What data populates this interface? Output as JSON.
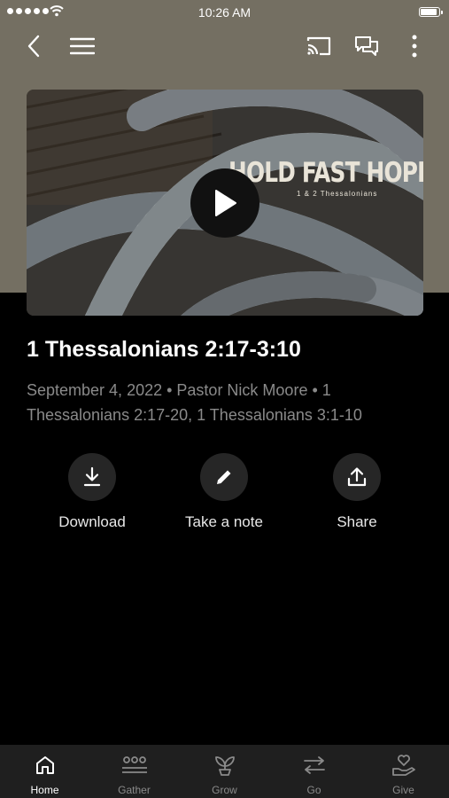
{
  "status_bar": {
    "time": "10:26 AM"
  },
  "header": {
    "back_icon": "chevron-left-icon",
    "menu_icon": "hamburger-menu-icon",
    "cast_icon": "cast-icon",
    "chat_icon": "chat-icon",
    "more_icon": "more-vertical-icon"
  },
  "video": {
    "thumbnail_title": "HOLD FAST HOPE",
    "thumbnail_subtitle": "1 & 2 Thessalonians",
    "play_icon": "play-icon"
  },
  "sermon": {
    "title": "1 Thessalonians 2:17-3:10",
    "meta": "September 4, 2022 • Pastor Nick Moore • 1 Thessalonians 2:17-20, 1 Thessalonians 3:1-10"
  },
  "actions": [
    {
      "label": "Download",
      "icon": "download-icon"
    },
    {
      "label": "Take a note",
      "icon": "pencil-icon"
    },
    {
      "label": "Share",
      "icon": "share-icon"
    }
  ],
  "tabs": [
    {
      "label": "Home",
      "icon": "home-icon",
      "active": true
    },
    {
      "label": "Gather",
      "icon": "group-icon",
      "active": false
    },
    {
      "label": "Grow",
      "icon": "plant-icon",
      "active": false
    },
    {
      "label": "Go",
      "icon": "arrows-icon",
      "active": false
    },
    {
      "label": "Give",
      "icon": "heart-hand-icon",
      "active": false
    }
  ],
  "colors": {
    "header_bg": "#746f62",
    "background": "#000000",
    "tabbar_bg": "#1f1f1f",
    "inactive_tab": "#8a8a8a"
  }
}
